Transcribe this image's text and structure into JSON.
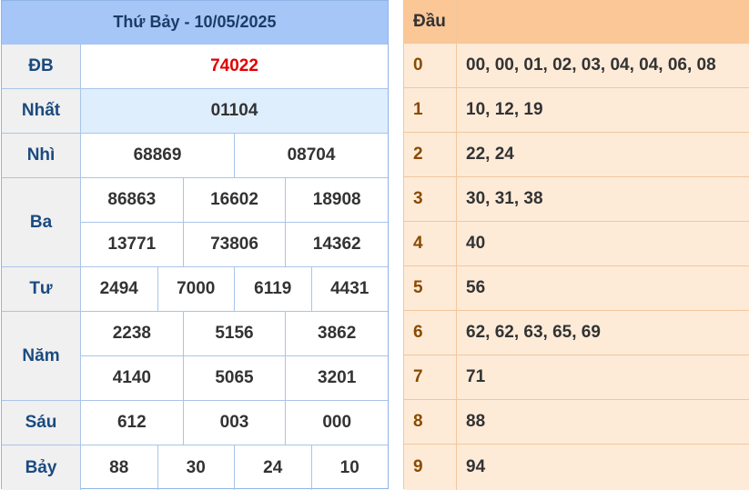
{
  "results": {
    "title": "Thứ Bảy - 10/05/2025",
    "rows": [
      {
        "label": "ĐB",
        "lines": [
          [
            "74022"
          ]
        ]
      },
      {
        "label": "Nhất",
        "lines": [
          [
            "01104"
          ]
        ]
      },
      {
        "label": "Nhì",
        "lines": [
          [
            "68869",
            "08704"
          ]
        ]
      },
      {
        "label": "Ba",
        "lines": [
          [
            "86863",
            "16602",
            "18908"
          ],
          [
            "13771",
            "73806",
            "14362"
          ]
        ]
      },
      {
        "label": "Tư",
        "lines": [
          [
            "2494",
            "7000",
            "6119",
            "4431"
          ]
        ]
      },
      {
        "label": "Năm",
        "lines": [
          [
            "2238",
            "5156",
            "3862"
          ],
          [
            "4140",
            "5065",
            "3201"
          ]
        ]
      },
      {
        "label": "Sáu",
        "lines": [
          [
            "612",
            "003",
            "000"
          ]
        ]
      },
      {
        "label": "Bảy",
        "lines": [
          [
            "88",
            "30",
            "24",
            "10"
          ]
        ]
      }
    ],
    "colors": {
      "special": "#e00000",
      "header": "#a6c6f8",
      "label_text": "#1a4a80"
    }
  },
  "head_table": {
    "header": "Đầu",
    "rows": [
      {
        "digit": "0",
        "values": "00, 00, 01, 02, 03, 04, 04, 06, 08"
      },
      {
        "digit": "1",
        "values": "10, 12, 19"
      },
      {
        "digit": "2",
        "values": "22, 24"
      },
      {
        "digit": "3",
        "values": "30, 31, 38"
      },
      {
        "digit": "4",
        "values": "40"
      },
      {
        "digit": "5",
        "values": "56"
      },
      {
        "digit": "6",
        "values": "62, 62, 63, 65, 69"
      },
      {
        "digit": "7",
        "values": "71"
      },
      {
        "digit": "8",
        "values": "88"
      },
      {
        "digit": "9",
        "values": "94"
      }
    ],
    "colors": {
      "header": "#fbc797",
      "row": "#fdebd8"
    }
  }
}
